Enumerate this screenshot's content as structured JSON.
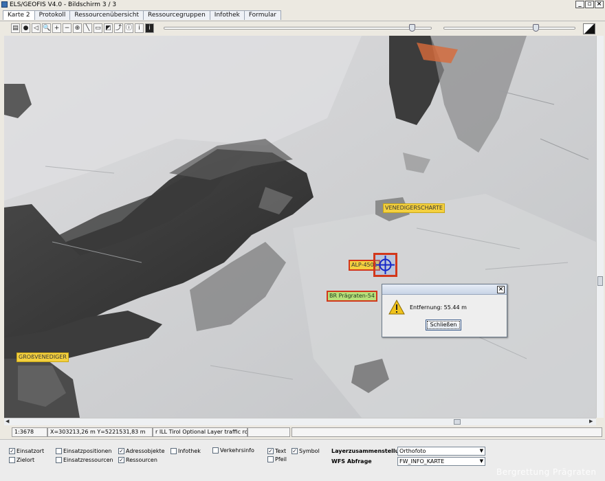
{
  "window": {
    "title": "ELS/GEOFIS V4.0 - Bildschirm 3 / 3",
    "controls": [
      "_",
      "▫",
      "×"
    ]
  },
  "tabs": [
    {
      "label": "Karte 2",
      "active": true
    },
    {
      "label": "Protokoll"
    },
    {
      "label": "Ressourcenübersicht"
    },
    {
      "label": "Ressourcegruppen"
    },
    {
      "label": "Infothek"
    },
    {
      "label": "Formular"
    }
  ],
  "toolbar": {
    "tools": [
      {
        "name": "layers-icon",
        "glyph": "▤"
      },
      {
        "name": "dot-icon",
        "glyph": "●"
      },
      {
        "name": "back-icon",
        "glyph": "◁"
      },
      {
        "name": "magnifier-icon",
        "glyph": "🔍"
      },
      {
        "name": "zoom-in-icon",
        "glyph": "+"
      },
      {
        "name": "zoom-out-icon",
        "glyph": "−"
      },
      {
        "name": "zoom-fit-icon",
        "glyph": "⊕"
      },
      {
        "name": "measure-line-icon",
        "glyph": "╲"
      },
      {
        "name": "ruler-icon",
        "glyph": "▭"
      },
      {
        "name": "area-icon",
        "glyph": "◩"
      },
      {
        "name": "route-icon",
        "glyph": "⤴"
      },
      {
        "name": "info-circle-icon",
        "glyph": "ⓘ"
      },
      {
        "name": "info-box-icon",
        "glyph": "i"
      },
      {
        "name": "info-dark-icon",
        "glyph": "i"
      }
    ],
    "slider1_value": 0.94,
    "slider2_value": 0.7
  },
  "map": {
    "labels": {
      "venediger": "VENEDIGERSCHARTE",
      "alp": "ALP-4501",
      "br": "BR Prägraten-54",
      "gross": "GROßVENEDIGER"
    }
  },
  "dialog": {
    "text": "Entfernung: 55.44 m",
    "button": "Schließen"
  },
  "statusbar": {
    "scale": "1:3678",
    "coords": "X=303213,26 m Y=5221531,83 m",
    "layer": "r ILL Tirol Optional Layer traffic route"
  },
  "bottom": {
    "checkboxes": {
      "einsatzort": {
        "label": "Einsatzort",
        "checked": true
      },
      "zielort": {
        "label": "Zielort",
        "checked": false
      },
      "einsatzpositionen": {
        "label": "Einsatzpositionen",
        "checked": false
      },
      "einsatzressourcen": {
        "label": "Einsatzressourcen",
        "checked": false
      },
      "adressobjekte": {
        "label": "Adressobjekte",
        "checked": true
      },
      "ressourcen": {
        "label": "Ressourcen",
        "checked": true
      },
      "infothek": {
        "label": "Infothek",
        "checked": false
      },
      "verkehrsinfo": {
        "label": "Verkehrsinfo",
        "checked": false
      },
      "text": {
        "label": "Text",
        "checked": true
      },
      "pfeil": {
        "label": "Pfeil",
        "checked": false
      },
      "symbol": {
        "label": "Symbol",
        "checked": true
      }
    },
    "layer_label": "Layerzusammenstellung",
    "layer_value": "Orthofoto",
    "wfs_label": "WFS Abfrage",
    "wfs_value": "FW_INFO_KARTE"
  },
  "watermark": "Bergrettung Prägraten"
}
